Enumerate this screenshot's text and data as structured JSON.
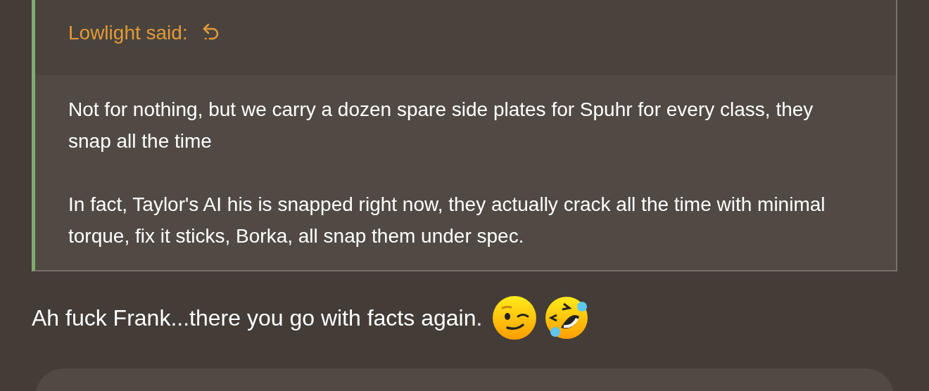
{
  "quote": {
    "author_label": "Lowlight said:",
    "paragraphs": [
      "Not for nothing, but we carry a dozen spare side plates for Spuhr for every class, they snap all the time",
      "In fact, Taylor's AI his is snapped right now, they actually crack all the time with minimal torque, fix it sticks, Borka, all snap them under spec."
    ]
  },
  "message": {
    "text": "Ah fuck Frank...there you go with facts again."
  }
}
